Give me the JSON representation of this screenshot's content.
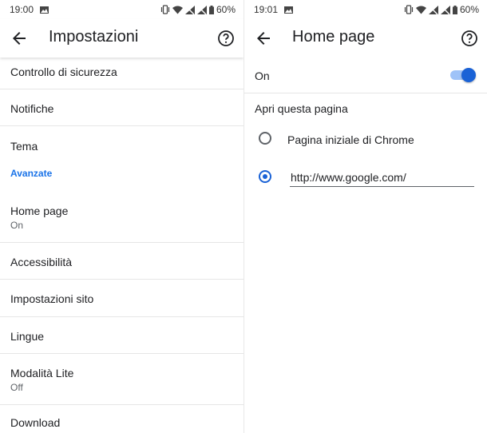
{
  "left": {
    "status": {
      "time": "19:00",
      "battery": "60%"
    },
    "appbar": {
      "title": "Impostazioni"
    },
    "items": [
      {
        "title": "Controllo di sicurezza"
      },
      {
        "title": "Notifiche"
      },
      {
        "title": "Tema"
      }
    ],
    "section_label": "Avanzate",
    "advanced_items": [
      {
        "title": "Home page",
        "subtitle": "On"
      },
      {
        "title": "Accessibilità"
      },
      {
        "title": "Impostazioni sito"
      },
      {
        "title": "Lingue"
      },
      {
        "title": "Modalità Lite",
        "subtitle": "Off"
      },
      {
        "title": "Download"
      }
    ]
  },
  "right": {
    "status": {
      "time": "19:01",
      "battery": "60%"
    },
    "appbar": {
      "title": "Home page"
    },
    "toggle": {
      "label": "On",
      "on": true
    },
    "open_this_page_label": "Apri questa pagina",
    "options": [
      {
        "label": "Pagina iniziale di Chrome",
        "selected": false
      },
      {
        "value": "http://www.google.com/",
        "selected": true
      }
    ]
  },
  "colors": {
    "accent": "#1a62d6",
    "section_label": "#1a73e8",
    "divider": "#e6e6e6"
  },
  "icons": [
    "back-arrow-icon",
    "help-icon",
    "photo-icon",
    "vibrate-icon",
    "wifi-icon",
    "no-signal-icon",
    "battery-icon"
  ]
}
